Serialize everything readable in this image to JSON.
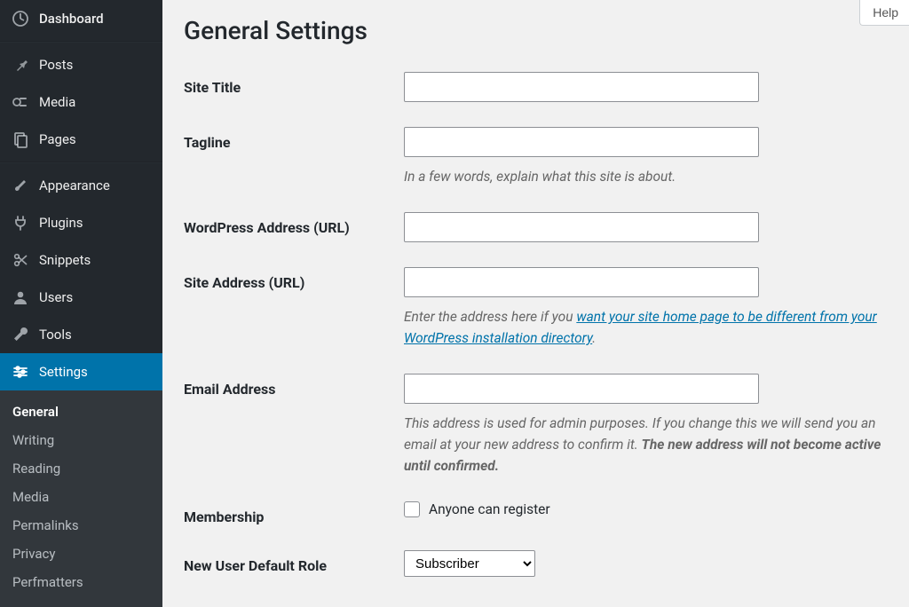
{
  "help_button": "Help",
  "sidebar": {
    "items": [
      {
        "id": "dashboard",
        "label": "Dashboard"
      },
      {
        "id": "posts",
        "label": "Posts"
      },
      {
        "id": "media",
        "label": "Media"
      },
      {
        "id": "pages",
        "label": "Pages"
      },
      {
        "id": "appearance",
        "label": "Appearance"
      },
      {
        "id": "plugins",
        "label": "Plugins"
      },
      {
        "id": "snippets",
        "label": "Snippets"
      },
      {
        "id": "users",
        "label": "Users"
      },
      {
        "id": "tools",
        "label": "Tools"
      },
      {
        "id": "settings",
        "label": "Settings"
      }
    ],
    "settings_submenu": [
      "General",
      "Writing",
      "Reading",
      "Media",
      "Permalinks",
      "Privacy",
      "Perfmatters"
    ]
  },
  "page": {
    "title": "General Settings",
    "form": {
      "site_title": {
        "label": "Site Title",
        "value": ""
      },
      "tagline": {
        "label": "Tagline",
        "value": "",
        "desc": "In a few words, explain what this site is about."
      },
      "wp_url": {
        "label": "WordPress Address (URL)",
        "value": ""
      },
      "site_url": {
        "label": "Site Address (URL)",
        "value": "",
        "desc_pre": "Enter the address here if you ",
        "desc_link1": "want your site home page to be different from your ",
        "desc_link2": "WordPress installation directory",
        "desc_post": "."
      },
      "email": {
        "label": "Email Address",
        "value": "",
        "desc_1": "This address is used for admin purposes. If you change this we will send you an email at your new address to confirm it. ",
        "desc_strong": "The new address will not become active until confirmed."
      },
      "membership": {
        "label": "Membership",
        "checkbox_label": "Anyone can register",
        "checked": false
      },
      "default_role": {
        "label": "New User Default Role",
        "value": "Subscriber"
      }
    }
  }
}
